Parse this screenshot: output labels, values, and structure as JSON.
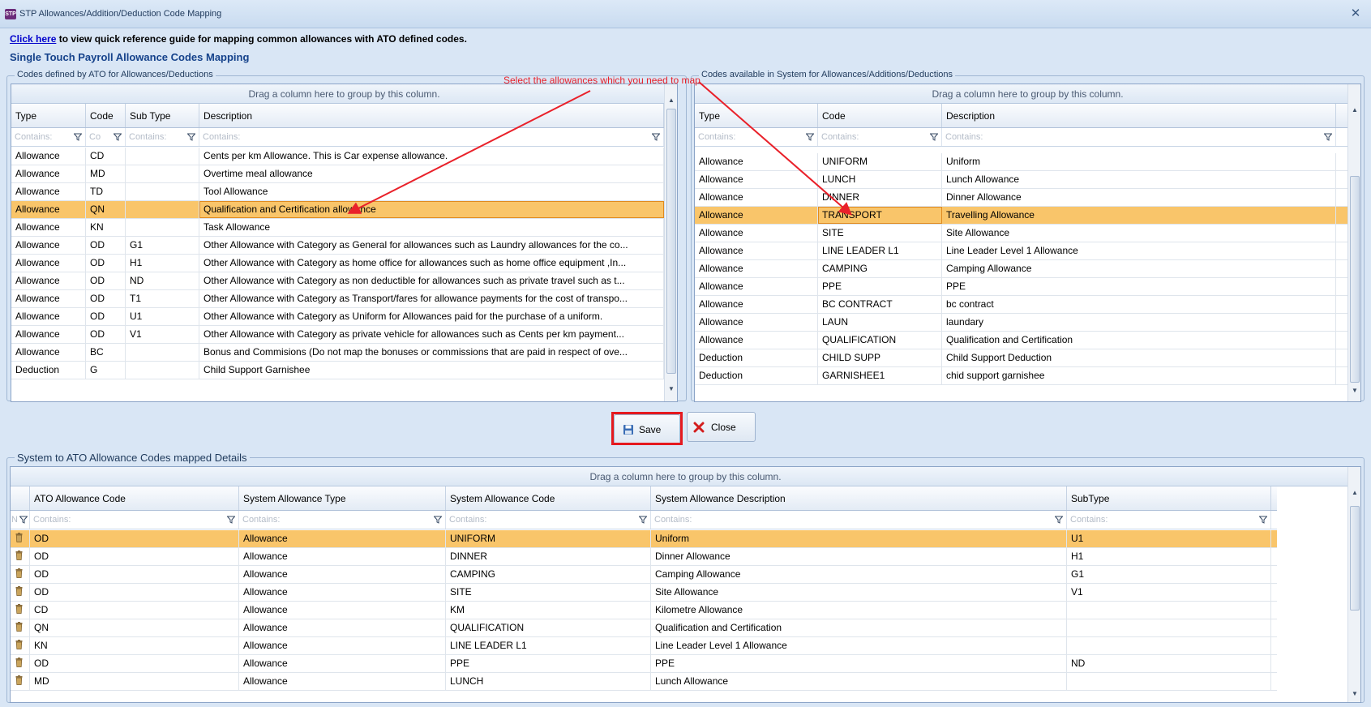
{
  "window": {
    "title": "STP Allowances/Addition/Deduction Code Mapping",
    "app_icon_text": "STP",
    "close_symbol": "✕"
  },
  "reference": {
    "link_text": "Click  here",
    "rest_text": " to view quick reference guide for mapping common allowances with ATO defined codes."
  },
  "heading": "Single Touch Payroll Allowance Codes Mapping",
  "annotation": "Select the allowances which you need to map",
  "ato_grid": {
    "group_title": "Codes defined by ATO for Allowances/Deductions",
    "group_panel_text": "Drag a column here to group by this column.",
    "columns": [
      "Type",
      "Code",
      "Sub Type",
      "Description"
    ],
    "filter_placeholders": [
      "Contains:",
      "Co",
      "Contains:",
      "Contains:"
    ],
    "selected_index": 3,
    "rows": [
      [
        "Allowance",
        "CD",
        "",
        "Cents per km Allowance. This is Car expense allowance."
      ],
      [
        "Allowance",
        "MD",
        "",
        "Overtime meal allowance"
      ],
      [
        "Allowance",
        "TD",
        "",
        "Tool Allowance"
      ],
      [
        "Allowance",
        "QN",
        "",
        "Qualification and Certification allowance"
      ],
      [
        "Allowance",
        "KN",
        "",
        "Task Allowance"
      ],
      [
        "Allowance",
        "OD",
        "G1",
        "Other Allowance with Category as General for allowances such as Laundry allowances for the co..."
      ],
      [
        "Allowance",
        "OD",
        "H1",
        "Other Allowance with Category as home office  for allowances such as home office equipment ,In..."
      ],
      [
        "Allowance",
        "OD",
        "ND",
        "Other Allowance with Category as non deductible  for allowances such as private travel such as t..."
      ],
      [
        "Allowance",
        "OD",
        "T1",
        "Other Allowance with Category as Transport/fares for allowance payments for the cost of transpo..."
      ],
      [
        "Allowance",
        "OD",
        "U1",
        "Other Allowance with Category as Uniform for Allowances paid for the purchase of a uniform."
      ],
      [
        "Allowance",
        "OD",
        "V1",
        "Other Allowance with Category as private vehicle for allowances such as Cents per km payment..."
      ],
      [
        "Allowance",
        "BC",
        "",
        "Bonus and Commisions (Do not map the bonuses or commissions that are paid in respect of ove..."
      ],
      [
        "Deduction",
        "G",
        "",
        "Child Support Garnishee"
      ]
    ]
  },
  "sys_grid": {
    "group_title": "Codes available in System for Allowances/Additions/Deductions",
    "group_panel_text": "Drag a column here to group by this column.",
    "columns": [
      "Type",
      "Code",
      "Description"
    ],
    "filter_placeholders": [
      "Contains:",
      "Contains:",
      "Contains:"
    ],
    "selected_index": 3,
    "rows": [
      [
        "Allowance",
        "UNIFORM",
        "Uniform"
      ],
      [
        "Allowance",
        "LUNCH",
        "Lunch Allowance"
      ],
      [
        "Allowance",
        "DINNER",
        "Dinner Allowance"
      ],
      [
        "Allowance",
        "TRANSPORT",
        "Travelling Allowance"
      ],
      [
        "Allowance",
        "SITE",
        "Site Allowance"
      ],
      [
        "Allowance",
        "LINE LEADER L1",
        "Line Leader Level 1 Allowance"
      ],
      [
        "Allowance",
        "CAMPING",
        "Camping Allowance"
      ],
      [
        "Allowance",
        "PPE",
        "PPE"
      ],
      [
        "Allowance",
        "BC CONTRACT",
        "bc contract"
      ],
      [
        "Allowance",
        "LAUN",
        "laundary"
      ],
      [
        "Allowance",
        "QUALIFICATION",
        "Qualification and Certification"
      ],
      [
        "Deduction",
        "CHILD SUPP",
        "Child Support Deduction"
      ],
      [
        "Deduction",
        "GARNISHEE1",
        "chid support garnishee"
      ]
    ]
  },
  "buttons": {
    "save": "Save",
    "close": "Close"
  },
  "mapped_grid": {
    "group_title": "System to ATO Allowance Codes mapped Details",
    "group_panel_text": "Drag a column here to group by this column.",
    "columns": [
      "ATO Allowance Code",
      "System Allowance Type",
      "System Allowance Code",
      "System Allowance Description",
      "SubType"
    ],
    "filter_placeholders": [
      "N",
      "Contains:",
      "Contains:",
      "Contains:",
      "Contains:",
      "Contains:"
    ],
    "selected_index": 0,
    "rows": [
      [
        "OD",
        "Allowance",
        "UNIFORM",
        "Uniform",
        "U1"
      ],
      [
        "OD",
        "Allowance",
        "DINNER",
        "Dinner Allowance",
        "H1"
      ],
      [
        "OD",
        "Allowance",
        "CAMPING",
        "Camping Allowance",
        "G1"
      ],
      [
        "OD",
        "Allowance",
        "SITE",
        "Site Allowance",
        "V1"
      ],
      [
        "CD",
        "Allowance",
        "KM",
        "Kilometre Allowance",
        ""
      ],
      [
        "QN",
        "Allowance",
        "QUALIFICATION",
        "Qualification and Certification",
        ""
      ],
      [
        "KN",
        "Allowance",
        "LINE LEADER L1",
        "Line Leader Level 1 Allowance",
        ""
      ],
      [
        "OD",
        "Allowance",
        "PPE",
        "PPE",
        "ND"
      ],
      [
        "MD",
        "Allowance",
        "LUNCH",
        "Lunch Allowance",
        ""
      ]
    ]
  },
  "colors": {
    "selected_row": "#f9c56a",
    "annotation": "#e9212a",
    "heading": "#15428b"
  }
}
